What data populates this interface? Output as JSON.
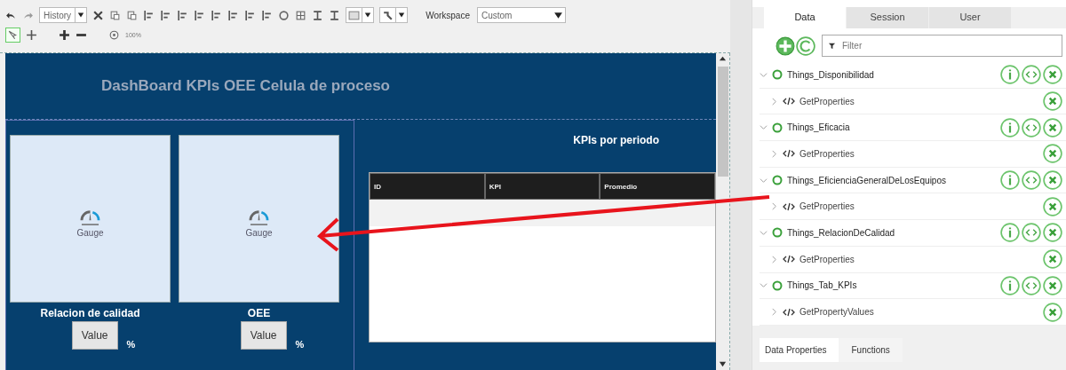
{
  "toolbar": {
    "history_select": "History",
    "zoom": "100%",
    "workspace_label": "Workspace",
    "workspace_select": "Custom"
  },
  "canvas": {
    "title": "DashBoard KPIs OEE Celula de proceso",
    "gauges": [
      {
        "label": "Gauge",
        "caption": "Relacion de calidad",
        "value": "Value",
        "unit": "%"
      },
      {
        "label": "Gauge",
        "caption": "OEE",
        "value": "Value",
        "unit": "%"
      }
    ],
    "kpi_panel": {
      "title": "KPIs por periodo",
      "columns": [
        "ID",
        "KPI",
        "Promedio"
      ]
    }
  },
  "panel": {
    "tabs": [
      {
        "label": "Data",
        "selected": true
      },
      {
        "label": "Session",
        "selected": false
      },
      {
        "label": "User",
        "selected": false
      }
    ],
    "filter": {
      "placeholder": "Filter"
    },
    "things": [
      {
        "name": "Things_Disponibilidad",
        "expanded": true,
        "services": [
          {
            "name": "GetProperties"
          }
        ]
      },
      {
        "name": "Things_Eficacia",
        "expanded": true,
        "services": [
          {
            "name": "GetProperties"
          }
        ]
      },
      {
        "name": "Things_EficienciaGeneralDeLosEquipos",
        "expanded": true,
        "services": [
          {
            "name": "GetProperties"
          }
        ]
      },
      {
        "name": "Things_RelacionDeCalidad",
        "expanded": true,
        "services": [
          {
            "name": "GetProperties"
          }
        ]
      },
      {
        "name": "Things_Tab_KPIs",
        "expanded": true,
        "services": [
          {
            "name": "GetPropertyValues"
          }
        ]
      }
    ],
    "bottom_tabs": [
      {
        "label": "Data Properties",
        "selected": true
      },
      {
        "label": "Functions",
        "selected": false
      }
    ]
  }
}
